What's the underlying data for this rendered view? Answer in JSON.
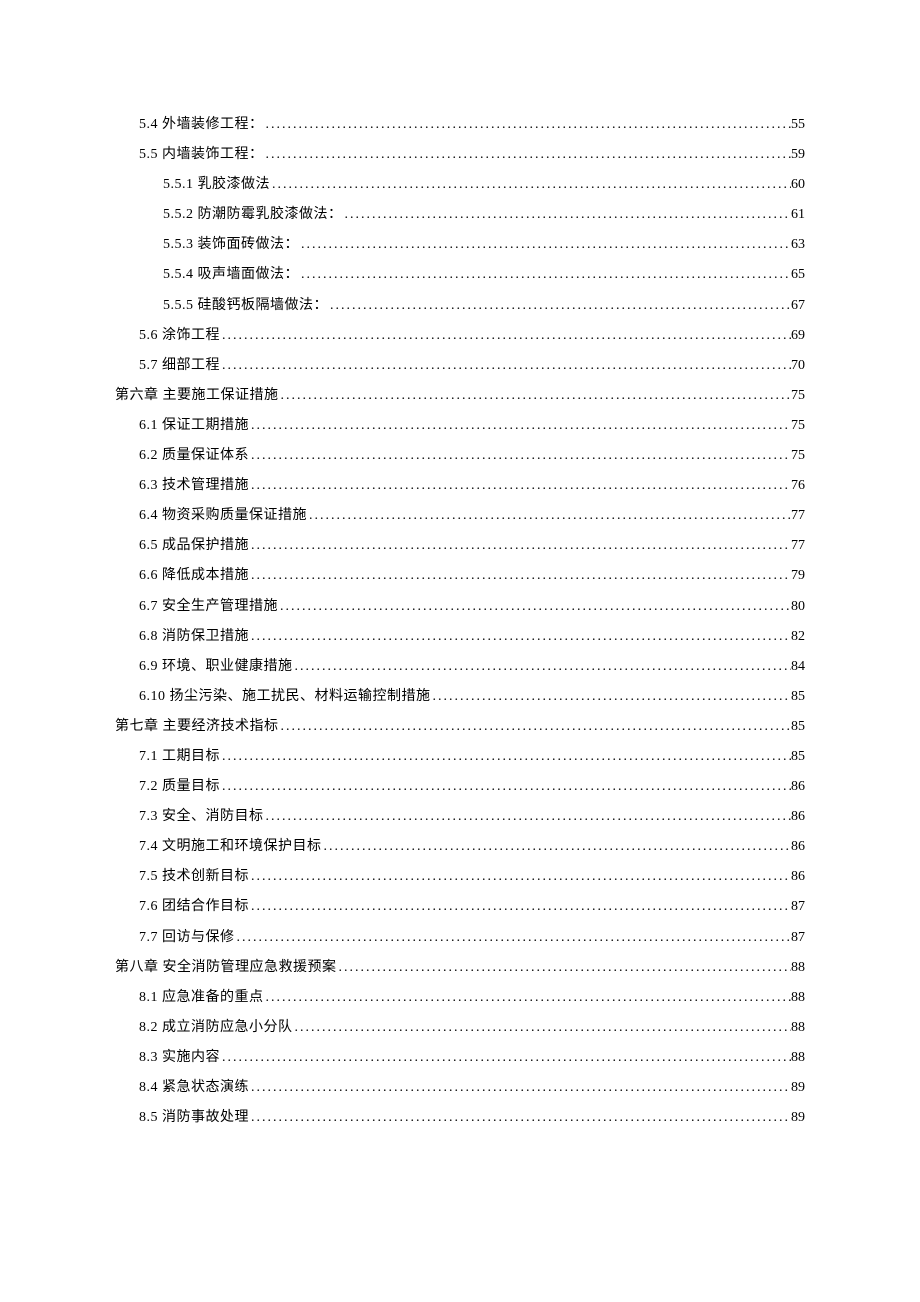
{
  "toc": [
    {
      "level": 2,
      "label": "5.4 外墙装修工程：",
      "page": "55"
    },
    {
      "level": 2,
      "label": "5.5 内墙装饰工程：",
      "page": "59"
    },
    {
      "level": 3,
      "label": "5.5.1 乳胶漆做法",
      "page": "60"
    },
    {
      "level": 3,
      "label": "5.5.2 防潮防霉乳胶漆做法：",
      "page": "61"
    },
    {
      "level": 3,
      "label": "5.5.3 装饰面砖做法：",
      "page": "63"
    },
    {
      "level": 3,
      "label": "5.5.4 吸声墙面做法：",
      "page": "65"
    },
    {
      "level": 3,
      "label": "5.5.5 硅酸钙板隔墙做法：",
      "page": "67"
    },
    {
      "level": 2,
      "label": "5.6 涂饰工程",
      "page": "69"
    },
    {
      "level": 2,
      "label": "5.7 细部工程",
      "page": "70"
    },
    {
      "level": 1,
      "label": "第六章 主要施工保证措施",
      "page": "75"
    },
    {
      "level": 2,
      "label": "6.1 保证工期措施",
      "page": "75"
    },
    {
      "level": 2,
      "label": "6.2 质量保证体系",
      "page": "75"
    },
    {
      "level": 2,
      "label": "6.3 技术管理措施",
      "page": "76"
    },
    {
      "level": 2,
      "label": "6.4 物资采购质量保证措施",
      "page": "77"
    },
    {
      "level": 2,
      "label": "6.5 成品保护措施",
      "page": "77"
    },
    {
      "level": 2,
      "label": "6.6 降低成本措施",
      "page": "79"
    },
    {
      "level": 2,
      "label": "6.7 安全生产管理措施",
      "page": "80"
    },
    {
      "level": 2,
      "label": "6.8 消防保卫措施",
      "page": "82"
    },
    {
      "level": 2,
      "label": "6.9 环境、职业健康措施",
      "page": "84"
    },
    {
      "level": 2,
      "label": "6.10 扬尘污染、施工扰民、材料运输控制措施",
      "page": "85"
    },
    {
      "level": 1,
      "label": "第七章 主要经济技术指标",
      "page": "85"
    },
    {
      "level": 2,
      "label": "7.1 工期目标",
      "page": "85"
    },
    {
      "level": 2,
      "label": "7.2 质量目标",
      "page": "86"
    },
    {
      "level": 2,
      "label": "7.3 安全、消防目标",
      "page": "86"
    },
    {
      "level": 2,
      "label": "7.4 文明施工和环境保护目标",
      "page": "86"
    },
    {
      "level": 2,
      "label": "7.5 技术创新目标",
      "page": "86"
    },
    {
      "level": 2,
      "label": "7.6 团结合作目标",
      "page": "87"
    },
    {
      "level": 2,
      "label": "7.7 回访与保修",
      "page": "87"
    },
    {
      "level": 1,
      "label": "第八章 安全消防管理应急救援预案",
      "page": "88"
    },
    {
      "level": 2,
      "label": "8.1 应急准备的重点",
      "page": "88"
    },
    {
      "level": 2,
      "label": "8.2 成立消防应急小分队",
      "page": "88"
    },
    {
      "level": 2,
      "label": "8.3 实施内容",
      "page": "88"
    },
    {
      "level": 2,
      "label": "8.4 紧急状态演练",
      "page": "89"
    },
    {
      "level": 2,
      "label": "8.5 消防事故处理",
      "page": "89"
    }
  ]
}
